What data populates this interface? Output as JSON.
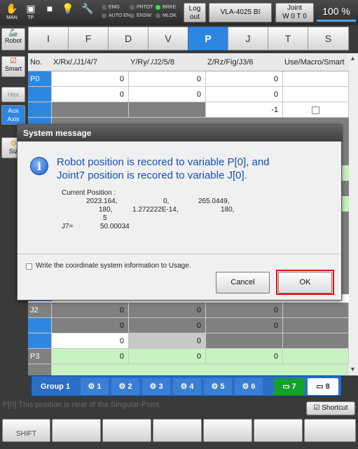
{
  "topbar": {
    "man_label": "MAN",
    "tp_label": "TP",
    "indicators": [
      {
        "label": "EMG",
        "on": false
      },
      {
        "label": "AUTO EN",
        "on": false
      },
      {
        "label": "PRTOT",
        "on": false
      },
      {
        "label": "ENSW",
        "on": false
      },
      {
        "label": "BRKE",
        "on": true
      },
      {
        "label": "MLOK",
        "on": false
      }
    ],
    "logout_label": "Log out",
    "robot_model": "VLA-4025 BI",
    "mode_label": "Joint",
    "mode_sub": "W 0 T 0",
    "speed": "100 %"
  },
  "side": {
    "robot": "Robot",
    "smart": "Smart",
    "hex": "Hex",
    "aux_axis": "Aux Axis",
    "size": "Siz"
  },
  "tabs": [
    "I",
    "F",
    "D",
    "V",
    "P",
    "J",
    "T",
    "S"
  ],
  "selected_tab": "P",
  "table": {
    "headers": [
      "No.",
      "X/Rx/./J1/4/7",
      "Y/Ry/./J2/5/8",
      "Z/Rz/Fig/J3/6",
      "Use/Macro/Smart"
    ],
    "rows_top": [
      {
        "no": "P0",
        "c1": "0",
        "c2": "0",
        "c3": "0"
      },
      {
        "no": "",
        "c1": "0",
        "c2": "0",
        "c3": "0"
      },
      {
        "no": "",
        "c1": "",
        "c2": "",
        "c3": "-1"
      }
    ],
    "rows_bottom": [
      {
        "no": "J2",
        "c1": "0",
        "c2": "0",
        "c3": "0"
      },
      {
        "no": "",
        "c1": "0",
        "c2": "0",
        "c3": "0"
      },
      {
        "no": "",
        "c1": "0",
        "c2": "0",
        "c3": ""
      },
      {
        "no": "P3",
        "c1": "0",
        "c2": "0",
        "c3": "0"
      }
    ]
  },
  "groupbar": {
    "group_label": "Group 1",
    "axes": [
      "1",
      "2",
      "3",
      "4",
      "5",
      "6",
      "7",
      "8"
    ]
  },
  "status_message": "P[0] This position is near of the Singular-Point",
  "shortcut_label": "Shortcut",
  "fkeys": [
    "SHIFT",
    "",
    "",
    "",
    "",
    "",
    ""
  ],
  "dialog": {
    "title": "System message",
    "message_line1": "Robot position is recored to variable P[0], and",
    "message_line2": "Joint7 position is recored to variable J[0].",
    "current_position_label": "Current Position :",
    "pos_row1": [
      "2023.164,",
      "0,",
      "265.0449,"
    ],
    "pos_row2": [
      "180,",
      "1.272222E-14,",
      "180,"
    ],
    "pos_row3": "5",
    "j7_label": "J7=",
    "j7_value": "50.00034",
    "usage_checkbox_label": "Write the coordinate system information to Usage.",
    "cancel_label": "Cancel",
    "ok_label": "OK"
  }
}
